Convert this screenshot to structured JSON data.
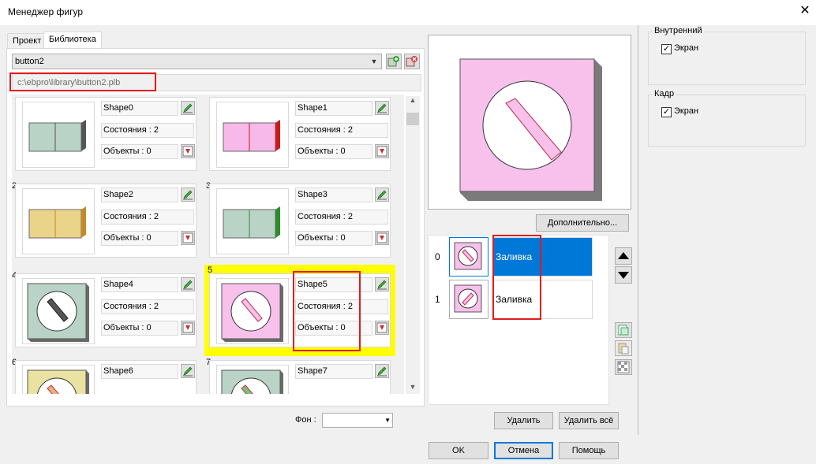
{
  "window": {
    "title": "Менеджер фигур",
    "close_glyph": "✕"
  },
  "tabs": [
    {
      "label": "Проект"
    },
    {
      "label": "Библиотека"
    }
  ],
  "library": {
    "selected": "button2",
    "path": "c:\\ebpro\\library\\button2.plb"
  },
  "shapes": [
    {
      "index": "",
      "name": "Shape0",
      "states": "Состояния : 2",
      "objects": "Объекты : 0",
      "kind": "bar",
      "color": "#b9d4c7",
      "accent": "#555555"
    },
    {
      "index": "",
      "name": "Shape1",
      "states": "Состояния : 2",
      "objects": "Объекты : 0",
      "kind": "bar",
      "color": "#f7b9ea",
      "accent": "#cc1a1a"
    },
    {
      "index": "2",
      "name": "Shape2",
      "states": "Состояния : 2",
      "objects": "Объекты : 0",
      "kind": "bar",
      "color": "#e9d48a",
      "accent": "#c28a28"
    },
    {
      "index": "3",
      "name": "Shape3",
      "states": "Состояния : 2",
      "objects": "Объекты : 0",
      "kind": "bar",
      "color": "#b9d4c7",
      "accent": "#2e8b2e"
    },
    {
      "index": "4",
      "name": "Shape4",
      "states": "Состояния : 2",
      "objects": "Объекты : 0",
      "kind": "knob",
      "color": "#b9d4c7",
      "accent": "#555555"
    },
    {
      "index": "5",
      "name": "Shape5",
      "states": "Состояния : 2",
      "objects": "Объекты : 0",
      "kind": "knob",
      "color": "#f7c1ec",
      "accent": "#f7c1ec"
    },
    {
      "index": "6",
      "name": "Shape6",
      "states": "",
      "objects": "",
      "kind": "knob",
      "color": "#e9e2a0",
      "accent": "#e9b07a"
    },
    {
      "index": "7",
      "name": "Shape7",
      "states": "",
      "objects": "",
      "kind": "knob",
      "color": "#b9d4c7",
      "accent": "#7ac27a"
    }
  ],
  "preview": {
    "color": "#f7c1ec"
  },
  "buttons": {
    "more": "Дополнительно...",
    "delete": "Удалить",
    "delete_all": "Удалить всё",
    "ok": "OK",
    "cancel": "Отмена",
    "help": "Помощь"
  },
  "layers": [
    {
      "index": "0",
      "label": "Заливка",
      "selected": true
    },
    {
      "index": "1",
      "label": "Заливка",
      "selected": false
    }
  ],
  "background": {
    "label": "Фон :",
    "value": ""
  },
  "groups": [
    {
      "title": "Внутренний",
      "checkbox_label": "Экран",
      "checked": true
    },
    {
      "title": "Кадр",
      "checkbox_label": "Экран",
      "checked": true
    }
  ]
}
